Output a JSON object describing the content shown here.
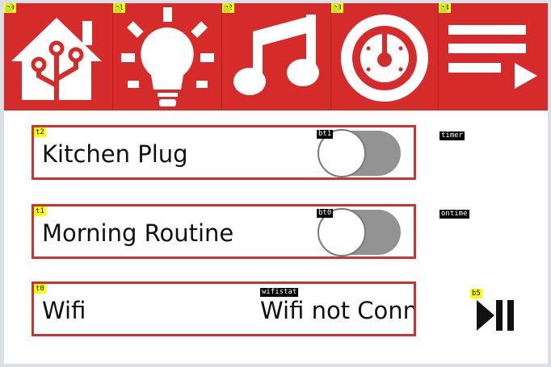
{
  "colors": {
    "accent": "#d62b2b",
    "border": "#cc3333",
    "toggle_off": "#939393"
  },
  "topbar": [
    {
      "id": "b0",
      "icon": "home-assistant-icon"
    },
    {
      "id": "b1",
      "icon": "lightbulb-icon"
    },
    {
      "id": "b2",
      "icon": "music-note-icon"
    },
    {
      "id": "b3",
      "icon": "timer-dial-icon"
    },
    {
      "id": "b4",
      "icon": "playlist-icon"
    }
  ],
  "rows": [
    {
      "id": "t2",
      "label": "Kitchen Plug",
      "toggle_id": "bt1",
      "toggle_on": false,
      "side_tag": "timer"
    },
    {
      "id": "t1",
      "label": "Morning Routine",
      "toggle_id": "bt0",
      "toggle_on": false,
      "side_tag": "ontime"
    },
    {
      "id": "t0",
      "label": "Wifi",
      "status_id": "wifistat",
      "status": "Wifi not Connected"
    }
  ],
  "play_pause": {
    "id": "b5",
    "icon": "play-pause-icon"
  }
}
